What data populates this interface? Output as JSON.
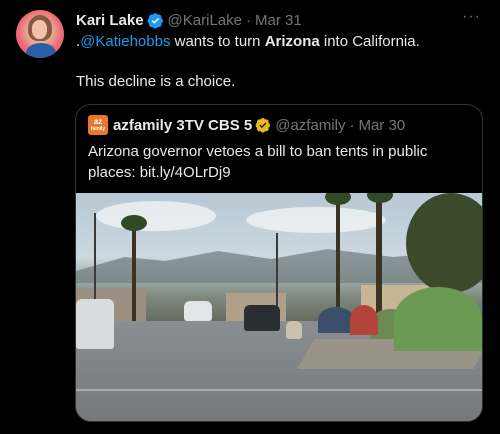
{
  "tweet": {
    "author_name": "Kari Lake",
    "author_handle": "@KariLake",
    "separator": "·",
    "date": "Mar 31",
    "more_label": "···",
    "text_prefix": ".",
    "mention": "@Katiehobbs",
    "text_mid": " wants to turn ",
    "bold_word": "Arizona",
    "text_end": " into California.",
    "line2": "This decline is a choice."
  },
  "quote": {
    "logo_line1": "az",
    "logo_line2": "family",
    "author_name": "azfamily 3TV CBS 5",
    "author_handle": "@azfamily",
    "separator": "·",
    "date": "Mar 30",
    "text": "Arizona governor vetoes a bill to ban tents in public places: bit.ly/4OLrDj9"
  },
  "colors": {
    "background": "#000000",
    "text": "#e7e9ea",
    "secondary": "#71767b",
    "accent": "#1d9bf0",
    "gold_badge": "#e8b824",
    "border": "#2f3336",
    "azfamily_orange": "#e7782a"
  },
  "icons": {
    "verified": "verified-badge-icon",
    "gold_verified": "gold-verified-badge-icon",
    "more": "more-options-icon"
  }
}
